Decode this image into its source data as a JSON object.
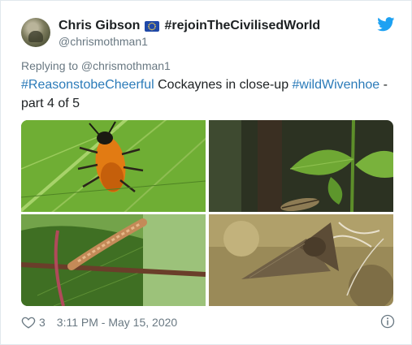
{
  "author": {
    "name": "Chris Gibson",
    "hashtag": "#rejoinTheCivilisedWorld",
    "handle": "@chrismothman1",
    "flag_icon": "eu-flag-icon"
  },
  "reply": {
    "text": "Replying to @chrismothman1"
  },
  "tweet": {
    "hashtag1": "#ReasonstobeCheerful",
    "text_mid": " Cockaynes in close-up ",
    "hashtag2": "#wildWivenhoe",
    "text_end": " - part 4 of 5"
  },
  "footer": {
    "likes": "3",
    "timestamp": "3:11 PM - May 15, 2020"
  },
  "colors": {
    "link": "#2b7bb9",
    "twitter_blue": "#1da1f2",
    "text": "#1c2022",
    "muted": "#697882"
  }
}
